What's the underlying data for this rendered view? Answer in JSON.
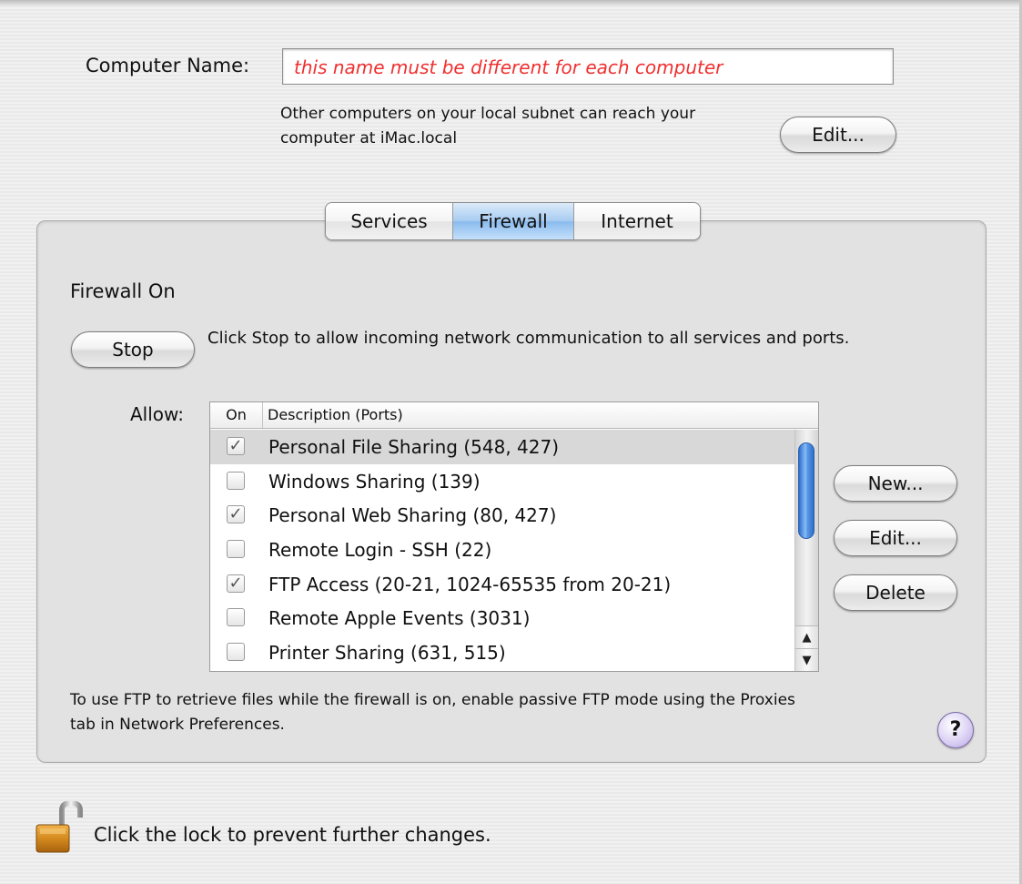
{
  "computer_name": {
    "label": "Computer Name:",
    "value": "this name must be different for each computer",
    "subnet_text_line1": "Other computers on your local subnet can reach your",
    "subnet_text_line2": "computer at iMac.local",
    "edit_label": "Edit..."
  },
  "tabs": [
    {
      "label": "Services",
      "active": false
    },
    {
      "label": "Firewall",
      "active": true
    },
    {
      "label": "Internet",
      "active": false
    }
  ],
  "firewall": {
    "status": "Firewall On",
    "stop_label": "Stop",
    "stop_description": "Click Stop to allow incoming network communication to all services and ports.",
    "allow_label": "Allow:",
    "columns": {
      "on": "On",
      "description": "Description (Ports)"
    },
    "services": [
      {
        "label": "Personal File Sharing (548, 427)",
        "checked": true,
        "selected": true
      },
      {
        "label": "Windows Sharing (139)",
        "checked": false,
        "selected": false
      },
      {
        "label": "Personal Web Sharing (80, 427)",
        "checked": true,
        "selected": false
      },
      {
        "label": "Remote Login - SSH (22)",
        "checked": false,
        "selected": false
      },
      {
        "label": "FTP Access (20-21, 1024-65535 from 20-21)",
        "checked": true,
        "selected": false
      },
      {
        "label": "Remote Apple Events (3031)",
        "checked": false,
        "selected": false
      },
      {
        "label": "Printer Sharing (631, 515)",
        "checked": false,
        "selected": false
      }
    ],
    "new_label": "New...",
    "edit_label": "Edit...",
    "delete_label": "Delete",
    "ftp_note_line1": "To use FTP to retrieve files while the firewall is on, enable passive FTP mode using the Proxies",
    "ftp_note_line2": "tab in Network Preferences.",
    "help_label": "?"
  },
  "lock": {
    "icon": "unlocked-padlock-icon",
    "text": "Click the lock to prevent further changes."
  },
  "colors": {
    "name_placeholder": "#f03030",
    "active_tab": "#a9cdf2",
    "scroll_thumb": "#4a8ae0",
    "help_button": "#c9b9ee"
  }
}
